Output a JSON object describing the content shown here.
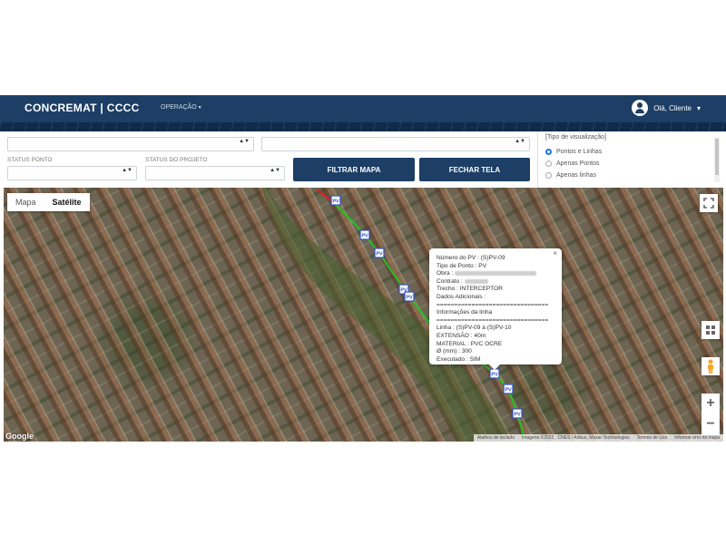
{
  "app": {
    "title": "CONCREMAT | CCCC"
  },
  "nav": {
    "operation": "OPERAÇÃO",
    "operation_caret": "▾",
    "user_label": "Olá, Cliente",
    "user_caret": "▾"
  },
  "filters": {
    "status_ponto_label": "STATUS PONTO",
    "status_projeto_label": "STATUS DO PROJETO",
    "filter_button": "FILTRAR MAPA",
    "close_button": "FECHAR TELA",
    "select_arrows": "▲▼"
  },
  "view_type": {
    "title": "[Tipo de visualização]",
    "options": [
      "Pontos e Linhas",
      "Apenas Pontos",
      "Apenas linhas"
    ],
    "selected": "Pontos e Linhas"
  },
  "map": {
    "type_options": [
      "Mapa",
      "Satélite"
    ],
    "active_type": "Satélite",
    "zoom_in": "+",
    "zoom_out": "−",
    "google_logo": "Google",
    "attribution": [
      "Atalhos do teclado",
      "Imagens ©2022 , CNES / Airbus, Maxar Technologies",
      "Termos de Uso",
      "Informar erro no mapa"
    ],
    "marker_label": "PV",
    "colors": {
      "line_green": "#22c322",
      "line_red": "#e02020",
      "marker": "#2f4fbf"
    }
  },
  "info_window": {
    "close": "×",
    "numero_pv": "Número do PV : (S)PV-09",
    "tipo_ponto": "Tipo de Ponto : PV",
    "obra_label": "Obra :",
    "contrato_label": "Contrato :",
    "trecho": "Trecho : INTERCEPTOR",
    "dados_adicionais": "Dados Adicionais :",
    "separator": "================================",
    "info_linha": "Informações da linha",
    "linha": "Linha : (S)PV-09 à (S)PV-10",
    "extensao": "EXTENSÃO : 40m",
    "material": "MATERIAL : PVC OCRE",
    "diametro": "Ø (mm) : 300",
    "executado": "Executado : SIM"
  }
}
